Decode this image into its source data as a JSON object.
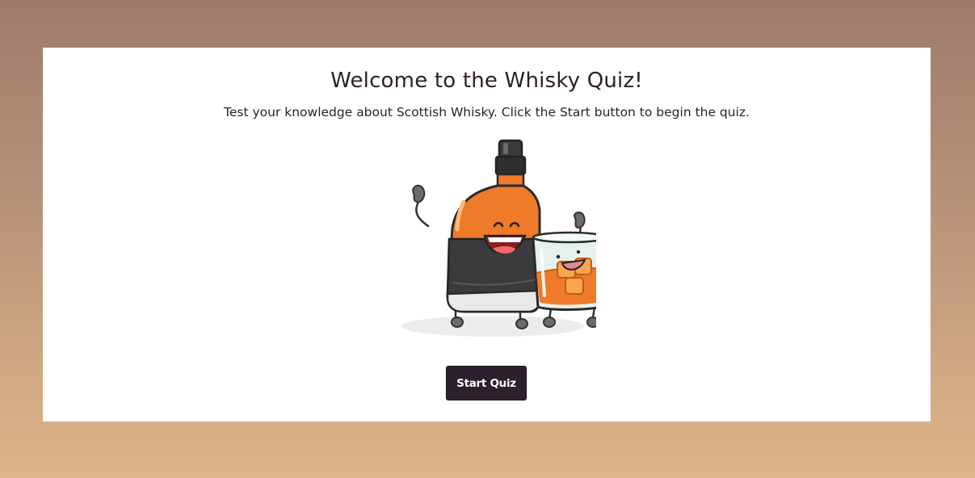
{
  "welcome": {
    "title": "Welcome to the Whisky Quiz!",
    "subtitle": "Test your knowledge about Scottish Whisky. Click the Start button to begin the quiz.",
    "illustration": "whisky-bottle-and-glass-cartoon",
    "start_button_label": "Start Quiz"
  },
  "colors": {
    "button_bg": "#2e1f2c",
    "text": "#2d1e2a",
    "background_top": "#9e7a6b",
    "background_bottom": "#dcb589",
    "whisky_orange": "#ef7a2a"
  }
}
